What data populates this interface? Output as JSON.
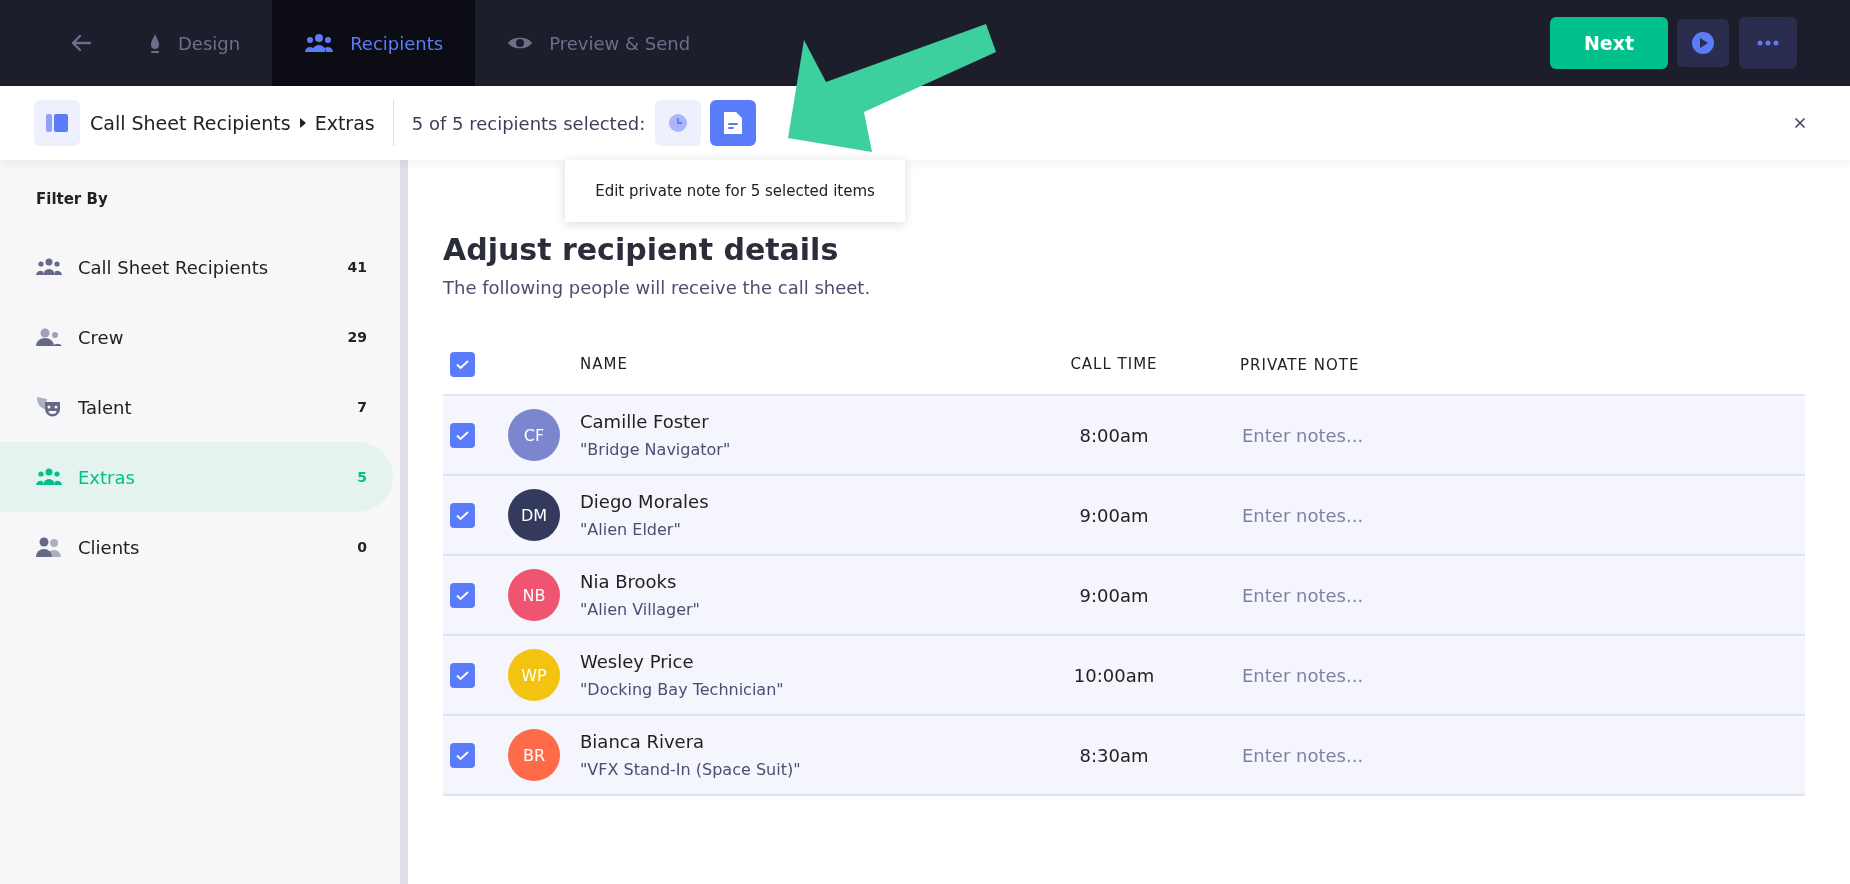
{
  "nav": {
    "tabs": [
      {
        "label": "Design",
        "selected": false
      },
      {
        "label": "Recipients",
        "selected": true
      },
      {
        "label": "Preview & Send",
        "selected": false
      }
    ],
    "next_button": "Next"
  },
  "toolbar": {
    "breadcrumb": [
      "Call Sheet Recipients",
      "Extras"
    ],
    "selection_text": "5 of 5 recipients selected:",
    "actions": [
      {
        "selected": false
      },
      {
        "selected": true
      }
    ],
    "tooltip": "Edit private note for 5 selected items"
  },
  "sidebar": {
    "heading": "Filter By",
    "items": [
      {
        "label": "Call Sheet Recipients",
        "count": "41",
        "selected": false
      },
      {
        "label": "Crew",
        "count": "29",
        "selected": false
      },
      {
        "label": "Talent",
        "count": "7",
        "selected": false
      },
      {
        "label": "Extras",
        "count": "5",
        "selected": true
      },
      {
        "label": "Clients",
        "count": "0",
        "selected": false
      }
    ]
  },
  "main": {
    "title": "Adjust recipient details",
    "subtitle": "The following people will receive the call sheet.",
    "table": {
      "all_checked": true,
      "columns": [
        "NAME",
        "CALL TIME",
        "PRIVATE NOTE"
      ],
      "rows": [
        {
          "checked": true,
          "initials": "CF",
          "color": "#7b86cf",
          "name": "Camille Foster",
          "role": "\"Bridge Navigator\"",
          "call_time": "8:00am",
          "note_placeholder": "Enter notes..."
        },
        {
          "checked": true,
          "initials": "DM",
          "color": "#333a5c",
          "name": "Diego Morales",
          "role": "\"Alien Elder\"",
          "call_time": "9:00am",
          "note_placeholder": "Enter notes..."
        },
        {
          "checked": true,
          "initials": "NB",
          "color": "#ef5470",
          "name": "Nia Brooks",
          "role": "\"Alien Villager\"",
          "call_time": "9:00am",
          "note_placeholder": "Enter notes..."
        },
        {
          "checked": true,
          "initials": "WP",
          "color": "#f2c311",
          "name": "Wesley Price",
          "role": "\"Docking Bay Technician\"",
          "call_time": "10:00am",
          "note_placeholder": "Enter notes..."
        },
        {
          "checked": true,
          "initials": "BR",
          "color": "#fd6b4a",
          "name": "Bianca Rivera",
          "role": "\"VFX Stand-In (Space Suit)\"",
          "call_time": "8:30am",
          "note_placeholder": "Enter notes..."
        }
      ]
    }
  }
}
